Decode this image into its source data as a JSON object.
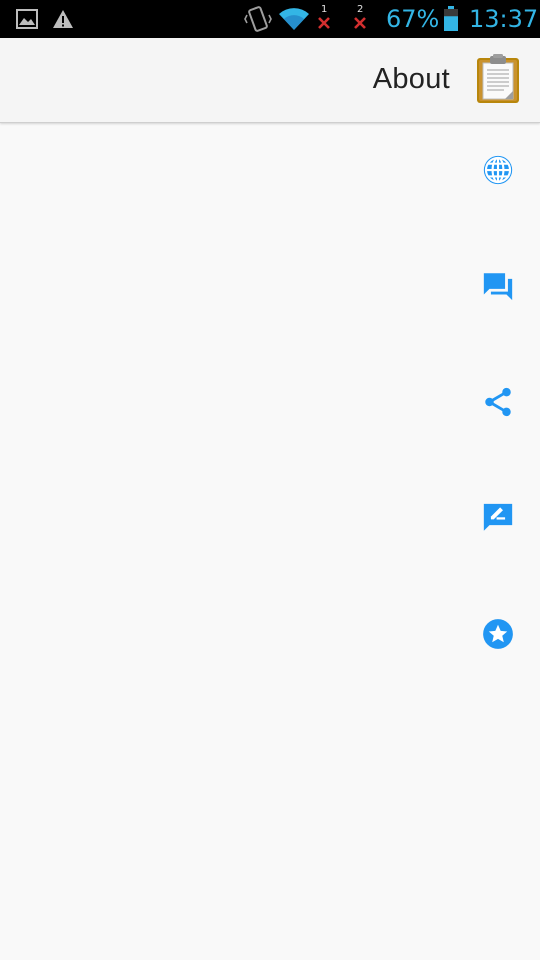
{
  "status_bar": {
    "battery_percent": "67%",
    "battery_level": 0.67,
    "time": "13:37",
    "sim1_label": "1",
    "sim2_label": "2",
    "icons": [
      "image-icon",
      "warning-icon",
      "vibrate-icon",
      "wifi-icon",
      "no-signal-sim1-icon",
      "no-signal-sim2-icon",
      "battery-icon"
    ]
  },
  "action_bar": {
    "title": "About",
    "icon": "clipboard-icon"
  },
  "side_actions": [
    {
      "icon": "globe-icon"
    },
    {
      "icon": "chat-icon"
    },
    {
      "icon": "share-icon"
    },
    {
      "icon": "feedback-icon"
    },
    {
      "icon": "star-icon"
    }
  ],
  "colors": {
    "accent": "#2196f3",
    "status_text": "#33b5e5",
    "background": "#f9f9f9"
  }
}
